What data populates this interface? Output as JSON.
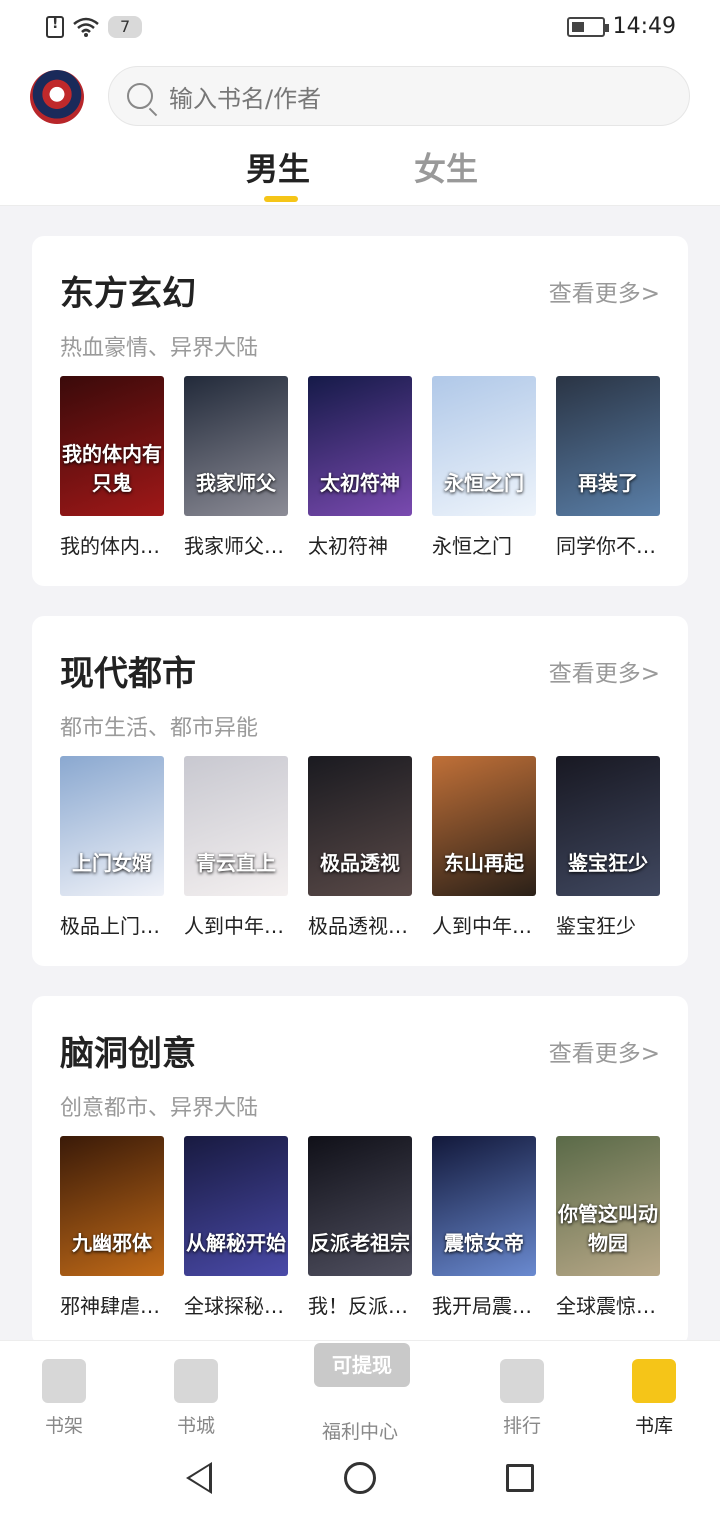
{
  "status_bar": {
    "notification_count": "7",
    "time": "14:49"
  },
  "search": {
    "placeholder": "输入书名/作者"
  },
  "tabs": {
    "male": "男生",
    "female": "女生"
  },
  "more_label": "查看更多>",
  "sections": [
    {
      "title": "东方玄幻",
      "subtitle": "热血豪情、异界大陆",
      "books": [
        {
          "name": "我的体内…",
          "cover_text": "我的体内有只鬼",
          "cover_colors": [
            "#3a0a0a",
            "#a01818"
          ]
        },
        {
          "name": "我家师父…",
          "cover_text": "我家师父",
          "cover_colors": [
            "#222a3a",
            "#8c8c96"
          ]
        },
        {
          "name": "太初符神",
          "cover_text": "太初符神",
          "cover_colors": [
            "#151a48",
            "#7a4ab0"
          ]
        },
        {
          "name": "永恒之门",
          "cover_text": "永恒之门",
          "cover_colors": [
            "#b0c8e8",
            "#eef4fb"
          ]
        },
        {
          "name": "同学你不…",
          "cover_text": "再装了",
          "cover_colors": [
            "#2a3444",
            "#5a7fa8"
          ]
        }
      ]
    },
    {
      "title": "现代都市",
      "subtitle": "都市生活、都市异能",
      "books": [
        {
          "name": "极品上门…",
          "cover_text": "上门女婿",
          "cover_colors": [
            "#8aa8d0",
            "#f0f2f8"
          ]
        },
        {
          "name": "人到中年…",
          "cover_text": "青云直上",
          "cover_colors": [
            "#c8c8d0",
            "#f4f0f0"
          ]
        },
        {
          "name": "极品透视…",
          "cover_text": "极品透视",
          "cover_colors": [
            "#1a1a20",
            "#5a4a48"
          ]
        },
        {
          "name": "人到中年…",
          "cover_text": "东山再起",
          "cover_colors": [
            "#c07038",
            "#2a2018"
          ]
        },
        {
          "name": "鉴宝狂少",
          "cover_text": "鉴宝狂少",
          "cover_colors": [
            "#181822",
            "#404860"
          ]
        }
      ]
    },
    {
      "title": "脑洞创意",
      "subtitle": "创意都市、异界大陆",
      "books": [
        {
          "name": "邪神肆虐…",
          "cover_text": "九幽邪体",
          "cover_colors": [
            "#3a1a08",
            "#c06a18"
          ]
        },
        {
          "name": "全球探秘…",
          "cover_text": "从解秘开始",
          "cover_colors": [
            "#181a40",
            "#4a4aa8"
          ]
        },
        {
          "name": "我！反派…",
          "cover_text": "反派老祖宗",
          "cover_colors": [
            "#101018",
            "#505060"
          ]
        },
        {
          "name": "我开局震…",
          "cover_text": "震惊女帝",
          "cover_colors": [
            "#12183a",
            "#6a8ad0"
          ]
        },
        {
          "name": "全球震惊…",
          "cover_text": "你管这叫动物园",
          "cover_colors": [
            "#5a6a48",
            "#b8a888"
          ]
        }
      ]
    }
  ],
  "bottom_nav": {
    "bookshelf": "书架",
    "bookstore": "书城",
    "welfare_badge": "可提现",
    "welfare": "福利中心",
    "rank": "排行",
    "library": "书库"
  }
}
